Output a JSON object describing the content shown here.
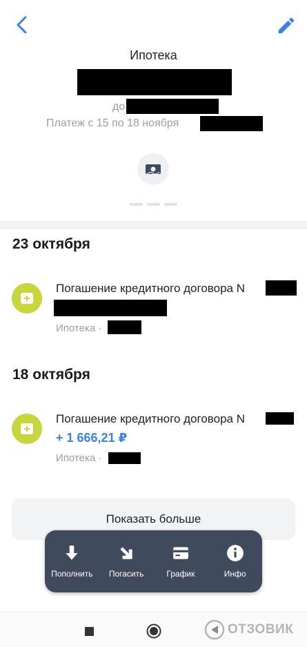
{
  "header": {
    "title": "Ипотека",
    "sub1_prefix": "до",
    "sub2": "Платеж с 15 по 18 ноября"
  },
  "transactions": [
    {
      "date": "23 октября",
      "name": "Погашение кредитного договора N",
      "amount": "",
      "meta": "Ипотека ·"
    },
    {
      "date": "18 октября",
      "name": "Погашение кредитного договора N",
      "amount": "+ 1 666,21 ₽",
      "meta": "Ипотека ·"
    }
  ],
  "show_more": "Показать больше",
  "actions": [
    {
      "label": "Пополнить",
      "icon": "arrow-down-icon"
    },
    {
      "label": "Погасить",
      "icon": "arrow-down-right-icon"
    },
    {
      "label": "График",
      "icon": "card-icon"
    },
    {
      "label": "Инфо",
      "icon": "info-icon"
    }
  ],
  "watermark": "ОТЗОВИК",
  "colors": {
    "accent": "#3c82e6",
    "tx_icon": "#c7d63d",
    "action_bar": "#3f4a5c"
  }
}
